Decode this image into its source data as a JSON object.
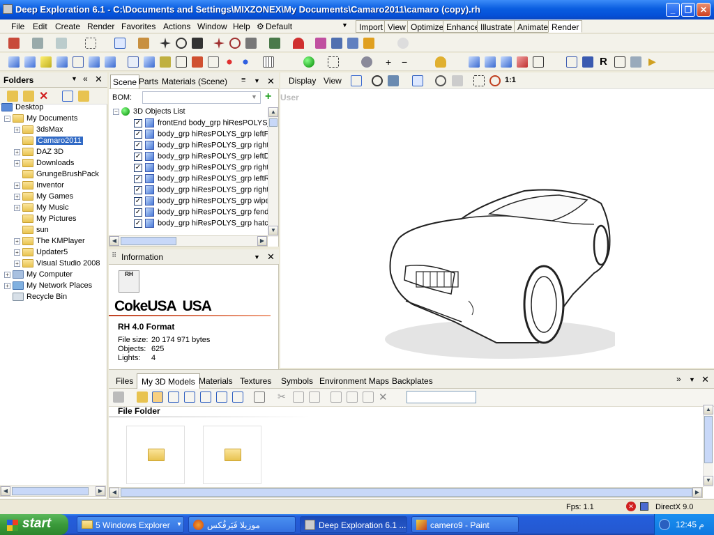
{
  "window": {
    "title": "Deep Exploration 6.1 - C:\\Documents and Settings\\MIXZONEX\\My Documents\\Camaro2011\\camaro (copy).rh"
  },
  "menu": {
    "items": [
      "File",
      "Edit",
      "Create",
      "Render",
      "Favorites",
      "Actions",
      "Window",
      "Help"
    ],
    "preset": "Default"
  },
  "mode_tabs": [
    "Import",
    "View",
    "Optimize",
    "Enhance",
    "Illustrate",
    "Animate",
    "Render"
  ],
  "folders": {
    "title": "Folders",
    "items": [
      "Desktop",
      "My Documents",
      "3dsMax",
      "Camaro2011",
      "DAZ 3D",
      "Downloads",
      "GrungeBrushPack",
      "Inventor",
      "My Games",
      "My Music",
      "My Pictures",
      "sun",
      "The KMPlayer",
      "Updater5",
      "Visual Studio 2008",
      "My Computer",
      "My Network Places",
      "Recycle Bin"
    ]
  },
  "scene": {
    "tabs": [
      "Scene",
      "Parts",
      "Materials (Scene)"
    ],
    "bom_label": "BOM:",
    "root": "3D Objects List",
    "objects": [
      "frontEnd body_grp hiResPOLYS_",
      "body_grp hiResPOLYS_grp leftFr",
      "body_grp hiResPOLYS_grp rightI",
      "body_grp hiResPOLYS_grp leftD",
      "body_grp hiResPOLYS_grp rightI",
      "body_grp hiResPOLYS_grp leftR",
      "body_grp hiResPOLYS_grp rightI",
      "body_grp hiResPOLYS_grp wiper",
      "body_grp hiResPOLYS_grp fende",
      "body_grp hiResPOLYS_grp hatch"
    ]
  },
  "info": {
    "title": "Information",
    "brand": "CokeUSA  USA",
    "format": "RH 4.0 Format",
    "file_size_label": "File size:",
    "file_size": "20 174 971 bytes",
    "objects_label": "Objects:",
    "objects": "625",
    "lights_label": "Lights:",
    "lights": "4"
  },
  "viewport": {
    "display": "Display",
    "view": "View",
    "zoom": "1:1",
    "camera": "User"
  },
  "bottom": {
    "tabs": [
      "Files",
      "My 3D Models",
      "Materials",
      "Textures",
      "Symbols",
      "Environment Maps",
      "Backplates"
    ],
    "section": "File Folder"
  },
  "status": {
    "fps": "Fps:  1.1",
    "renderer": "DirectX 9.0"
  },
  "taskbar": {
    "start": "start",
    "tasks": [
      "5 Windows Explorer",
      "موزيلا فَيَرفُكس",
      "Deep Exploration 6.1 ...",
      "camero9 - Paint"
    ],
    "clock": "12:45 م"
  }
}
